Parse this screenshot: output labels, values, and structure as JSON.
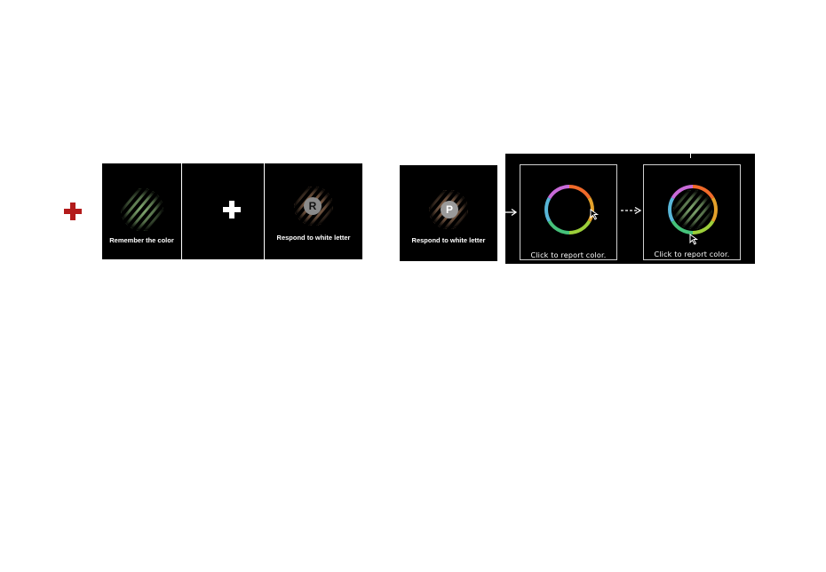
{
  "colors": {
    "fixation_red": "#b31b1b",
    "fixation_white": "#ffffff",
    "panel_bg": "#000000",
    "stim_green": "#9fd08a",
    "stim_orange": "#d9a27a"
  },
  "sequence1": {
    "panel1_caption": "Remember the color",
    "panel3_caption": "Respond to white letter",
    "panel3_letter": "R"
  },
  "sequence2": {
    "panel1_caption": "Respond to white letter",
    "panel1_letter": "P",
    "report_panel1_caption": "Click to report color.",
    "report_panel2_caption": "Click to report color."
  }
}
